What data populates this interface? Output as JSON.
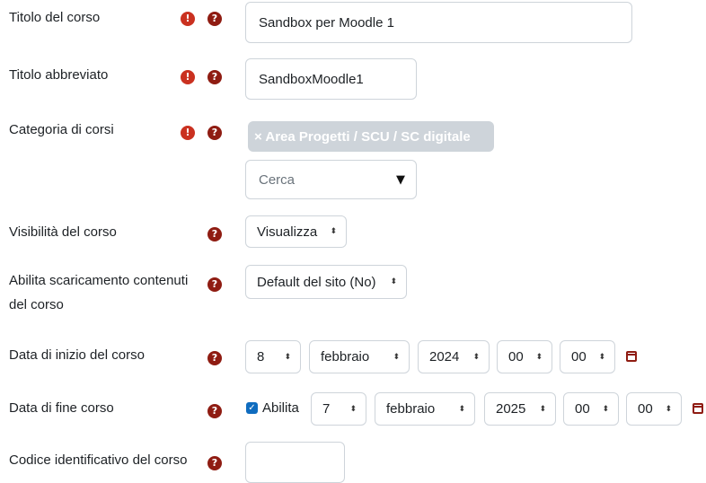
{
  "fields": {
    "titolo": {
      "label": "Titolo del corso",
      "value": "Sandbox per Moodle 1"
    },
    "abbreviato": {
      "label": "Titolo abbreviato",
      "value": "SandboxMoodle1"
    },
    "categoria": {
      "label": "Categoria di corsi",
      "tag": "× Area Progetti / SCU / SC digitale",
      "search_placeholder": "Cerca",
      "arrow": "▼"
    },
    "visibilita": {
      "label": "Visibilità del corso",
      "value": "Visualizza"
    },
    "scaricamento": {
      "label_line1": "Abilita scaricamento contenuti",
      "label_line2": "del corso",
      "value": "Default del sito (No)"
    },
    "inizio": {
      "label": "Data di inizio del corso",
      "day": "8",
      "month": "febbraio",
      "year": "2024",
      "hour": "00",
      "minute": "00"
    },
    "fine": {
      "label": "Data di fine corso",
      "enable_label": "Abilita",
      "enabled": true,
      "day": "7",
      "month": "febbraio",
      "year": "2025",
      "hour": "00",
      "minute": "00"
    },
    "codice": {
      "label": "Codice identificativo del corso",
      "value": ""
    }
  },
  "icons": {
    "required_glyph": "!",
    "help_glyph": "?",
    "select_arrow": "⬍",
    "check_glyph": "✓"
  },
  "colors": {
    "required": "#ca3120",
    "help": "#8f1c12",
    "tag_bg": "#ced4da",
    "checkbox": "#0f6cbf"
  }
}
